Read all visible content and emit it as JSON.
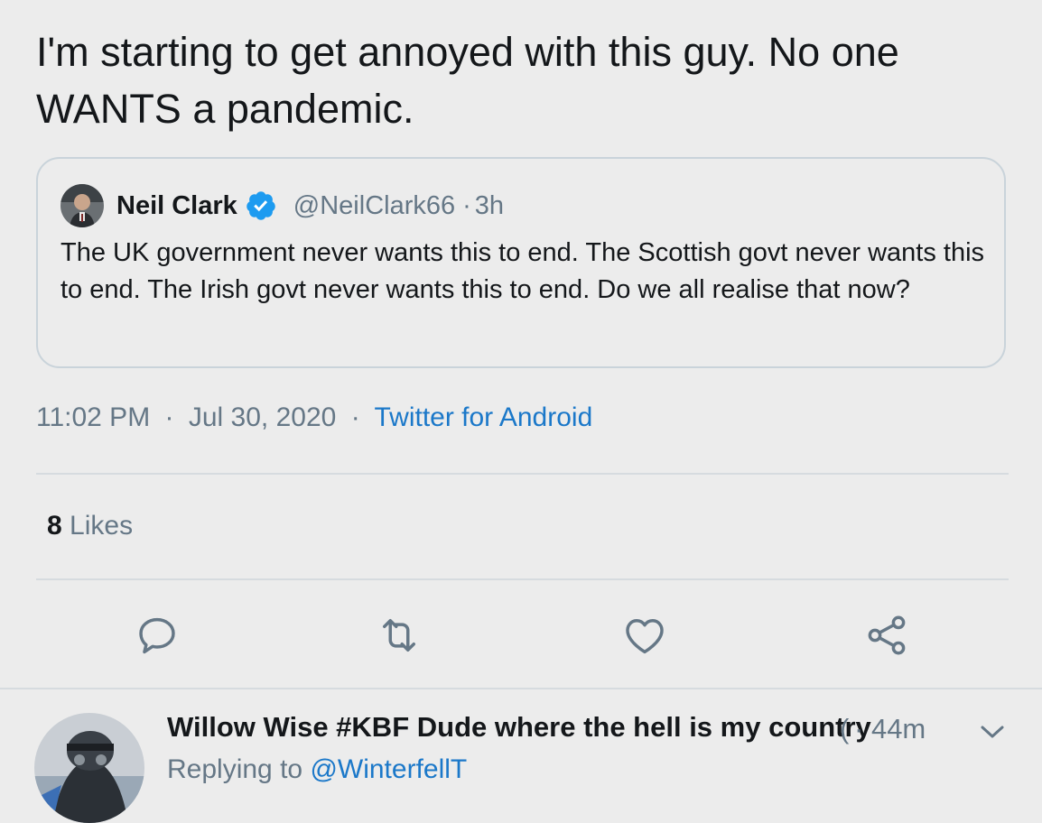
{
  "tweet": {
    "text": "I'm starting to get annoyed with this guy. No one WANTS a pandemic.",
    "time": "11:02 PM",
    "date": "Jul 30, 2020",
    "separator": "·",
    "source": "Twitter for Android",
    "likes_count": "8",
    "likes_label": "Likes"
  },
  "quote": {
    "name": "Neil Clark",
    "handle": "@NeilClark66",
    "dot": "·",
    "time": "3h",
    "text": "The UK government never wants this to end. The Scottish govt never wants this to end. The Irish govt never wants this to end. Do we all realise that now?"
  },
  "actions": {
    "reply": "reply-icon",
    "retweet": "retweet-icon",
    "like": "heart-icon",
    "share": "share-icon"
  },
  "reply": {
    "name": "Willow Wise #KBF Dude where the hell is my country",
    "truncation_mark": "(",
    "dot": "·",
    "time": "44m",
    "replying_prefix": "Replying to",
    "replying_to": "@WinterfellT"
  },
  "colors": {
    "link": "#1b78c9",
    "verified": "#1d9bf0",
    "muted": "#657786",
    "background": "#ececec"
  }
}
